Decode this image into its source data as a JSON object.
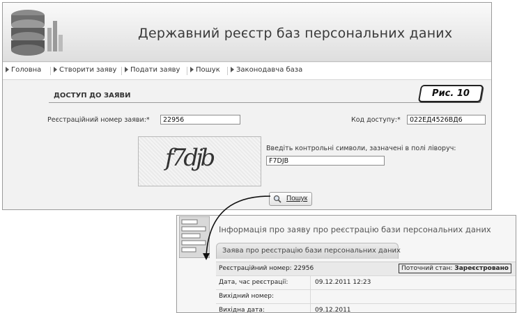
{
  "site_title": "Державний реєстр баз персональних даних",
  "nav": [
    {
      "label": "Головна"
    },
    {
      "label": "Створити заяву"
    },
    {
      "label": "Подати заяву"
    },
    {
      "label": "Пошук"
    },
    {
      "label": "Законодавча база"
    }
  ],
  "section_title": "ДОСТУП ДО ЗАЯВИ",
  "figure_label": "Рис. 10",
  "form": {
    "reg_number_label": "Реєстраційний номер заяви:*",
    "reg_number_value": "22956",
    "access_code_label": "Код доступу:*",
    "access_code_value": "022ЕД4526ВД6",
    "captcha_text": "f7djb",
    "captcha_prompt": "Введіть контрольні символи, зазначені в полі ліворуч:",
    "captcha_value": "F7DJB",
    "search_button": "Пошук"
  },
  "result": {
    "title": "Інформація про заяву про реєстрацію бази персональних даних",
    "tab_label": "Заява про реєстрацію бази персональних даних",
    "reg_number_text": "Реєстраційний номер: 22956",
    "status_label": "Поточний стан:",
    "status_value": "Зареєстровано",
    "rows": [
      {
        "label": "Дата, час реєстрації:",
        "value": "09.12.2011 12:23"
      },
      {
        "label": "Вихідний номер:",
        "value": ""
      },
      {
        "label": "Вихідна дата:",
        "value": "09.12.2011"
      }
    ]
  },
  "icons": {
    "logo": "database-stack-icon",
    "search": "magnifier-icon",
    "nav_bullet": "triangle-right-icon"
  }
}
